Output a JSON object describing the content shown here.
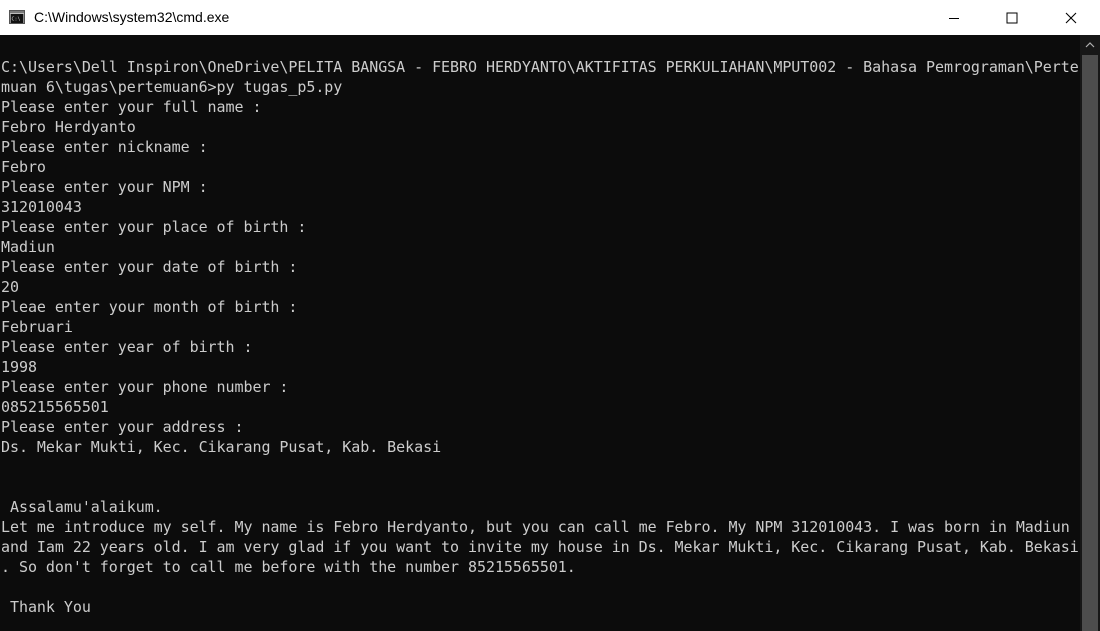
{
  "window": {
    "title": "C:\\Windows\\system32\\cmd.exe",
    "icon": "cmd-icon",
    "controls": [
      "minimize-icon",
      "maximize-icon",
      "close-icon"
    ]
  },
  "console": {
    "lines": [
      "C:\\Users\\Dell Inspiron\\OneDrive\\PELITA BANGSA - FEBRO HERDYANTO\\AKTIFITAS PERKULIAHAN\\MPUT002 - Bahasa Pemrograman\\Perte",
      "muan 6\\tugas\\pertemuan6>py tugas_p5.py",
      "Please enter your full name :",
      "Febro Herdyanto",
      "Please enter nickname :",
      "Febro",
      "Please enter your NPM :",
      "312010043",
      "Please enter your place of birth :",
      "Madiun",
      "Please enter your date of birth :",
      "20",
      "Pleae enter your month of birth :",
      "Februari",
      "Please enter year of birth :",
      "1998",
      "Please enter your phone number :",
      "085215565501",
      "Please enter your address :",
      "Ds. Mekar Mukti, Kec. Cikarang Pusat, Kab. Bekasi",
      "",
      "",
      " Assalamu'alaikum.",
      "Let me introduce my self. My name is Febro Herdyanto, but you can call me Febro. My NPM 312010043. I was born in Madiun",
      "and Iam 22 years old. I am very glad if you want to invite my house in Ds. Mekar Mukti, Kec. Cikarang Pusat, Kab. Bekasi",
      ". So don't forget to call me before with the number 85215565501.",
      "",
      " Thank You"
    ]
  },
  "colors": {
    "console_bg": "#0c0c0c",
    "console_text": "#cccccc",
    "titlebar_bg": "#ffffff",
    "scrollbar_track": "#171717",
    "scrollbar_thumb": "#4d4d4d"
  }
}
